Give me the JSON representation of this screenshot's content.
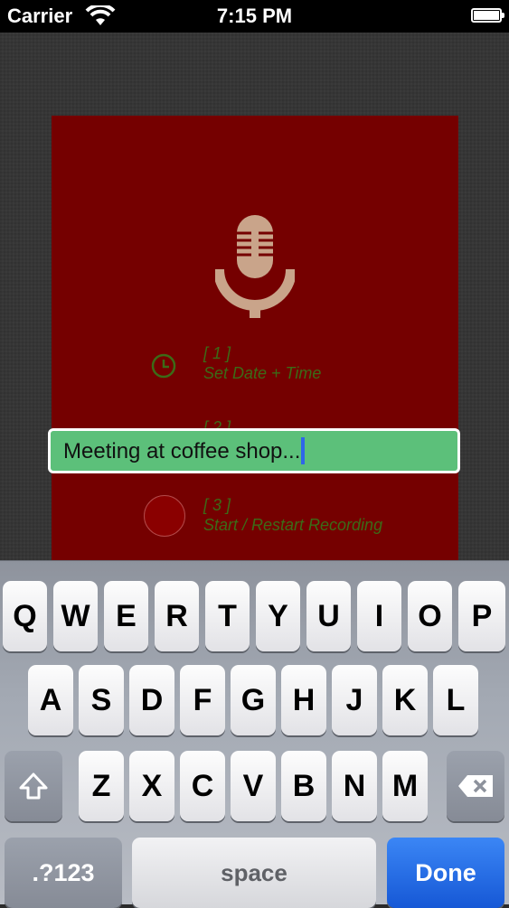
{
  "status_bar": {
    "carrier": "Carrier",
    "time": "7:15 PM"
  },
  "steps": [
    {
      "number": "[ 1 ]",
      "label": "Set Date + Time"
    },
    {
      "number": "[ 2 ]",
      "label": ""
    },
    {
      "number": "[ 3 ]",
      "label": "Start / Restart Recording"
    }
  ],
  "text_field": {
    "value": "Meeting at coffee shop..."
  },
  "keyboard": {
    "row1": [
      "Q",
      "W",
      "E",
      "R",
      "T",
      "Y",
      "U",
      "I",
      "O",
      "P"
    ],
    "row2": [
      "A",
      "S",
      "D",
      "F",
      "G",
      "H",
      "J",
      "K",
      "L"
    ],
    "row3": [
      "Z",
      "X",
      "C",
      "V",
      "B",
      "N",
      "M"
    ],
    "numbers_label": ".?123",
    "space_label": "space",
    "done_label": "Done"
  },
  "icons": [
    "wifi-icon",
    "battery-icon",
    "microphone-icon",
    "clock-icon",
    "record-icon",
    "shift-icon",
    "backspace-icon"
  ],
  "colors": {
    "panel": "#750000",
    "field": "#5cc07a",
    "step_text": "#3c6b17",
    "done": "#1f6ce6"
  }
}
